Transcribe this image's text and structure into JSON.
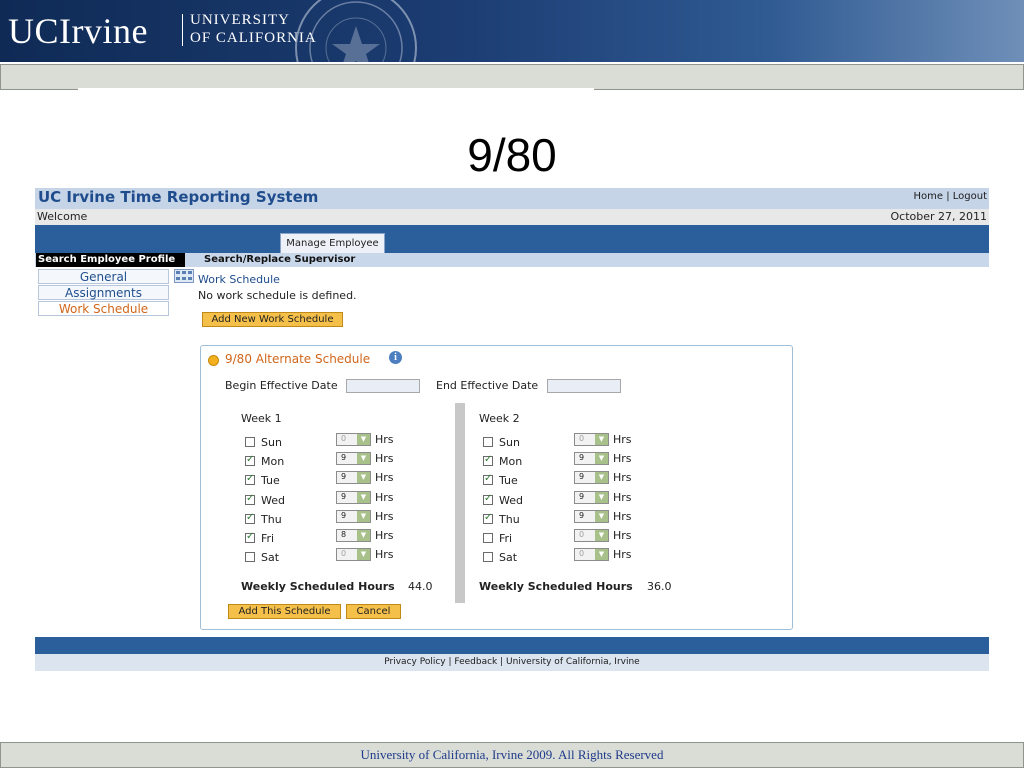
{
  "slide": {
    "logo_main": "UCIrvine",
    "logo_sub_line1": "UNIVERSITY",
    "logo_sub_line2": "OF CALIFORNIA",
    "title": "9/80",
    "footer": "University of California, Irvine 2009. All Rights Reserved"
  },
  "app": {
    "title": "UC Irvine Time Reporting System",
    "links": [
      "Home",
      "Logout"
    ],
    "welcome": "Welcome",
    "date": "October 27, 2011",
    "tab": "Manage Employee",
    "sub_nav": [
      "Search Employee Profile",
      "Search/Replace Supervisor"
    ],
    "sidebar": [
      {
        "label": "General",
        "active": false
      },
      {
        "label": "Assignments",
        "active": false
      },
      {
        "label": "Work Schedule",
        "active": true
      }
    ],
    "work_schedule_title": "Work Schedule",
    "no_schedule": "No work schedule is defined.",
    "add_new_button": "Add New Work Schedule",
    "panel": {
      "title": "9/80 Alternate Schedule",
      "info_icon": "i",
      "begin_label": "Begin Effective Date",
      "end_label": "End Effective Date",
      "begin_value": "",
      "end_value": "",
      "hrs_label": "Hrs",
      "total_label": "Weekly Scheduled Hours",
      "weeks": [
        {
          "name": "Week 1",
          "total": "44.0",
          "days": [
            {
              "day": "Sun",
              "checked": false,
              "hours": "0"
            },
            {
              "day": "Mon",
              "checked": true,
              "hours": "9"
            },
            {
              "day": "Tue",
              "checked": true,
              "hours": "9"
            },
            {
              "day": "Wed",
              "checked": true,
              "hours": "9"
            },
            {
              "day": "Thu",
              "checked": true,
              "hours": "9"
            },
            {
              "day": "Fri",
              "checked": true,
              "hours": "8"
            },
            {
              "day": "Sat",
              "checked": false,
              "hours": "0"
            }
          ]
        },
        {
          "name": "Week 2",
          "total": "36.0",
          "days": [
            {
              "day": "Sun",
              "checked": false,
              "hours": "0"
            },
            {
              "day": "Mon",
              "checked": true,
              "hours": "9"
            },
            {
              "day": "Tue",
              "checked": true,
              "hours": "9"
            },
            {
              "day": "Wed",
              "checked": true,
              "hours": "9"
            },
            {
              "day": "Thu",
              "checked": true,
              "hours": "9"
            },
            {
              "day": "Fri",
              "checked": false,
              "hours": "0"
            },
            {
              "day": "Sat",
              "checked": false,
              "hours": "0"
            }
          ]
        }
      ],
      "add_button": "Add This Schedule",
      "cancel_button": "Cancel"
    },
    "footer_links": [
      "Privacy Policy",
      "Feedback",
      "University of California, Irvine"
    ]
  }
}
